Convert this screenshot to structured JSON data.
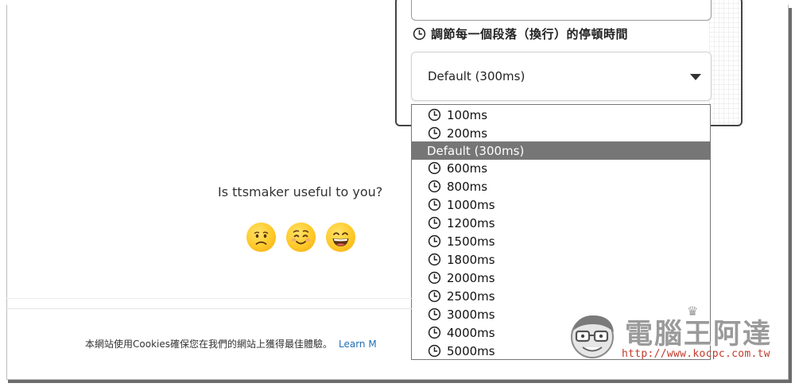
{
  "settings": {
    "pause_label": "調節每一個段落（換行）的停頓時間",
    "selected_value": "Default (300ms)"
  },
  "dropdown": {
    "options": [
      "100ms",
      "200ms",
      "Default (300ms)",
      "600ms",
      "800ms",
      "1000ms",
      "1200ms",
      "1500ms",
      "1800ms",
      "2000ms",
      "2500ms",
      "3000ms",
      "4000ms",
      "5000ms"
    ],
    "selected_index": 2
  },
  "feedback": {
    "question": "Is ttsmaker useful to you?",
    "emojis": [
      "frowning-face-icon",
      "smiling-face-icon",
      "grinning-face-icon"
    ]
  },
  "footer": {
    "cookie_text": "本網站使用Cookies確保您在我們的網站上獲得最佳體驗。",
    "learn_more": "Learn M"
  },
  "watermark": {
    "title": "電腦王阿達",
    "url": "http://www.kocpc.com.tw"
  },
  "colors": {
    "selected_bg": "#767676",
    "link": "#1f6fb5",
    "watermark_url": "#c0392b",
    "emoji_yellow": "#ffc928"
  }
}
